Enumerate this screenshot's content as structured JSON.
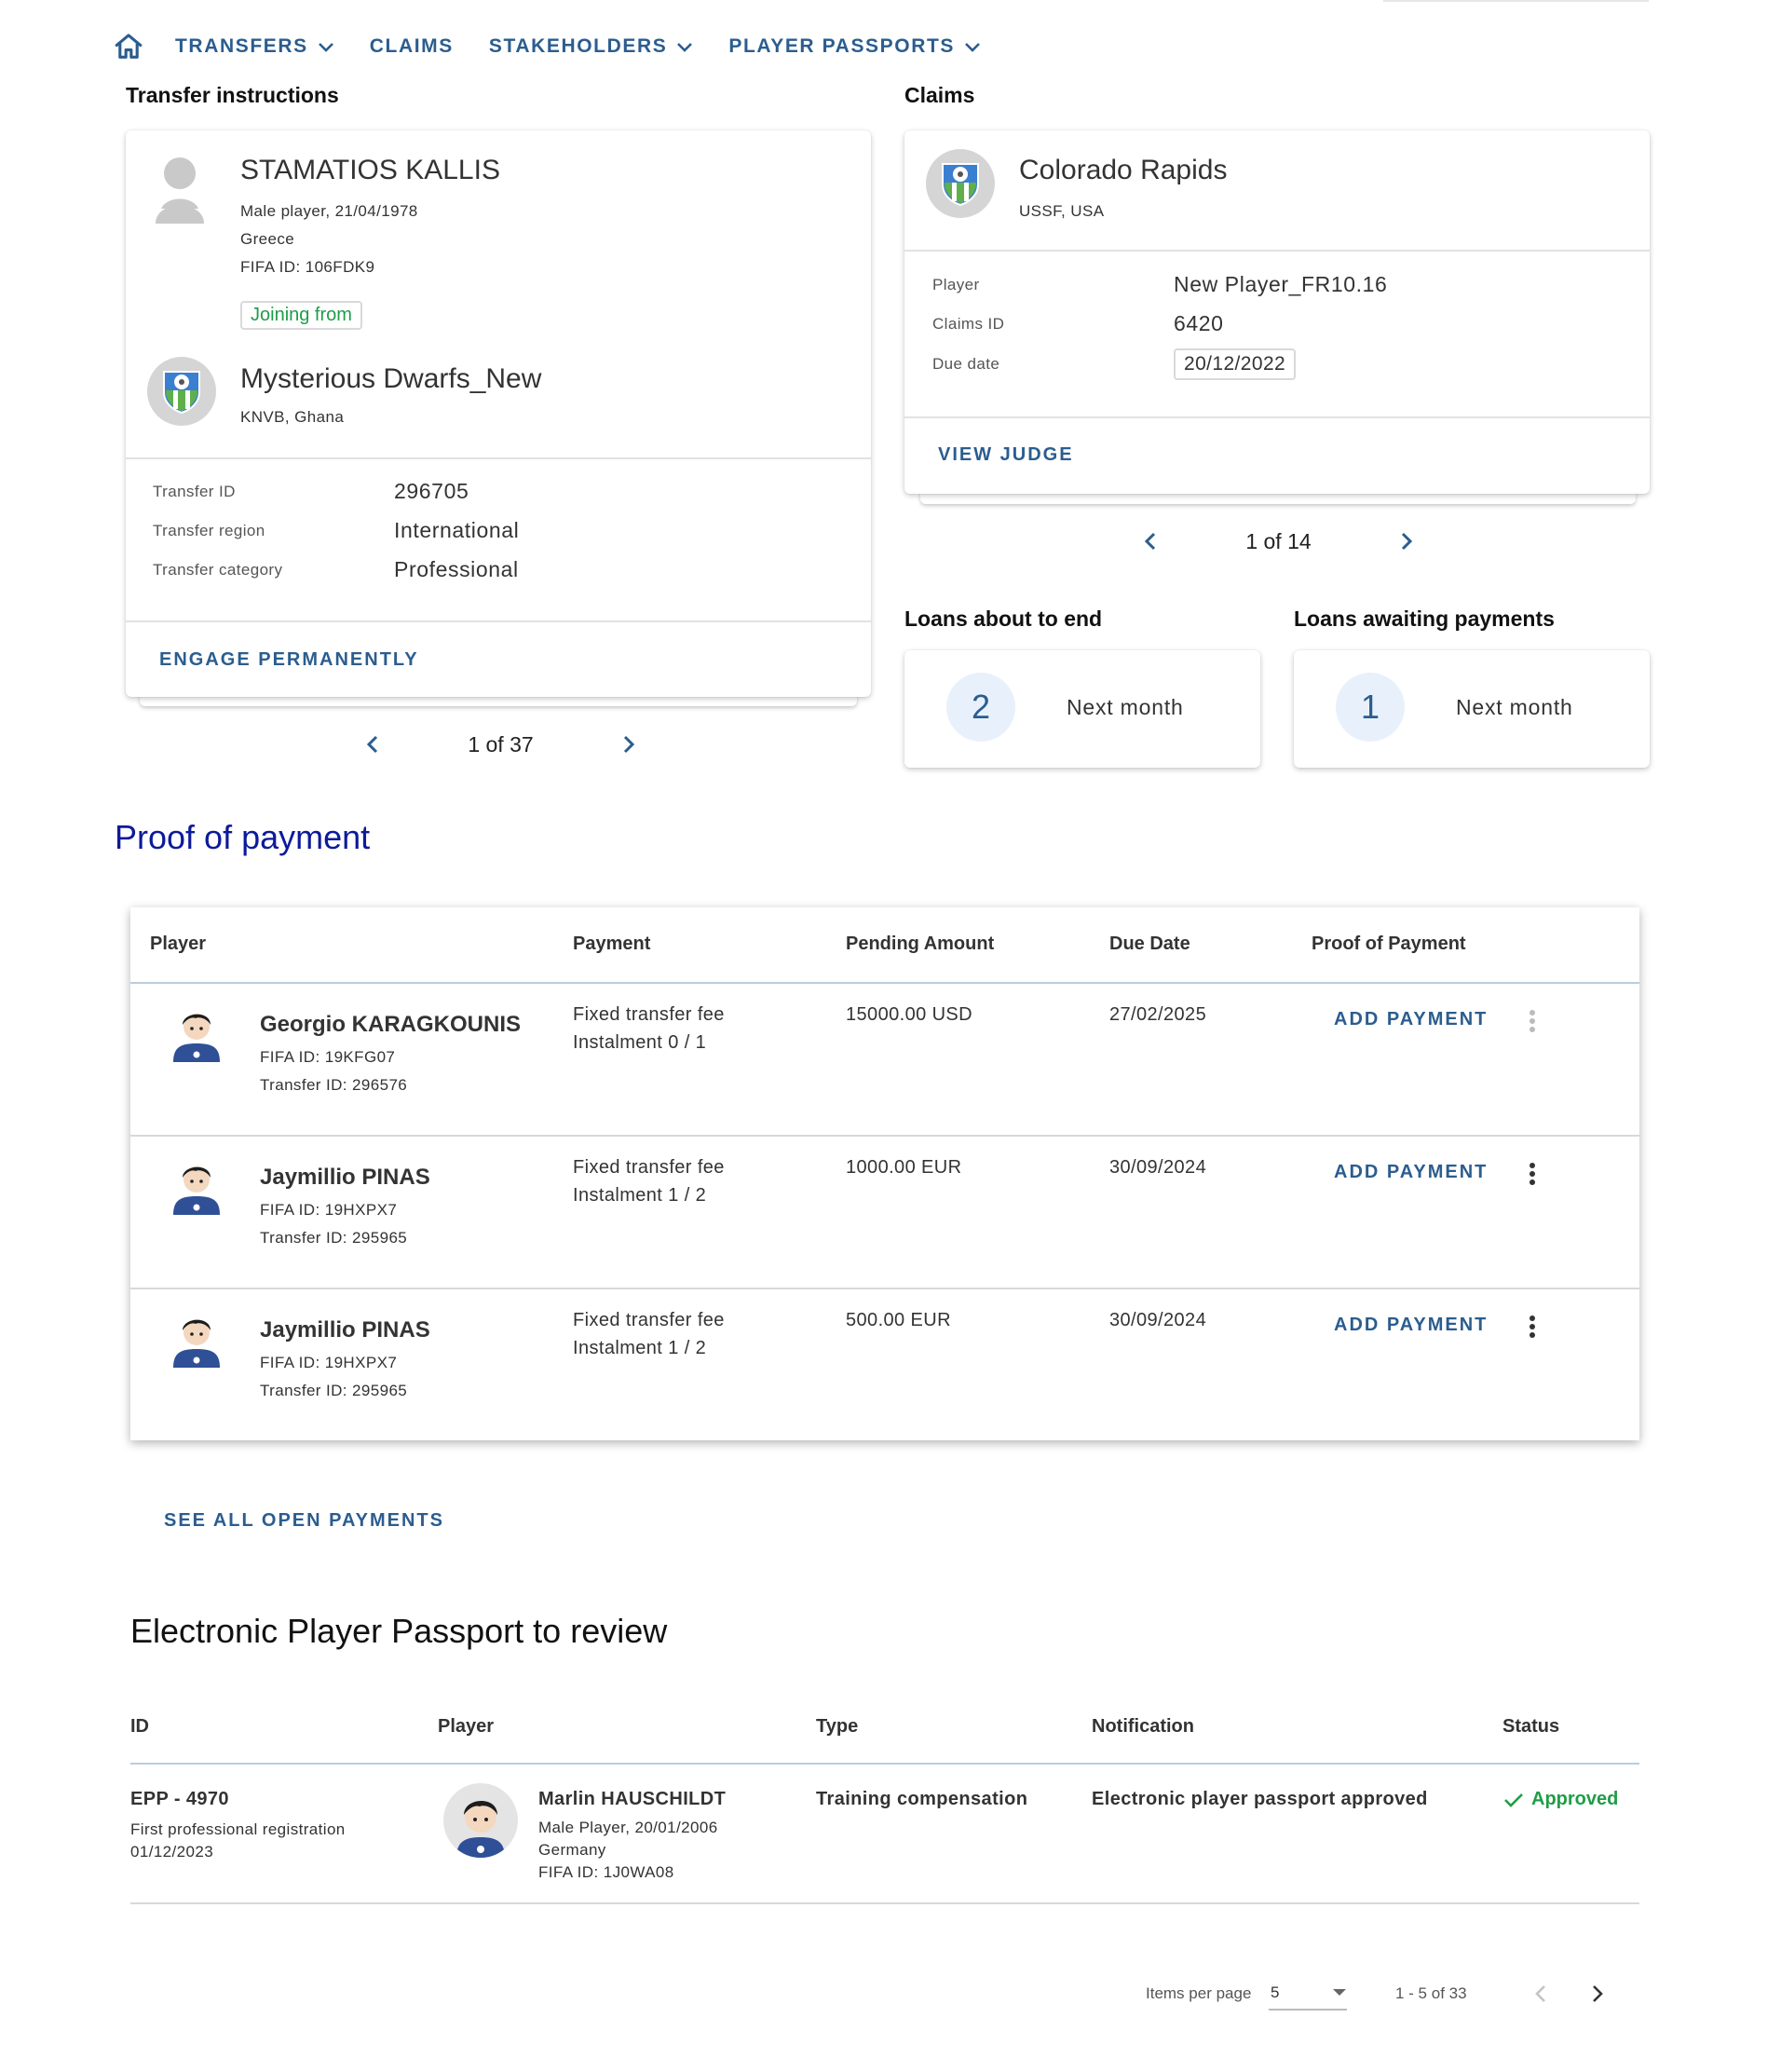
{
  "nav": {
    "items": [
      {
        "label": "TRANSFERS",
        "dropdown": true
      },
      {
        "label": "CLAIMS",
        "dropdown": false
      },
      {
        "label": "STAKEHOLDERS",
        "dropdown": true
      },
      {
        "label": "PLAYER PASSPORTS",
        "dropdown": true
      }
    ]
  },
  "transfer": {
    "section_title": "Transfer instructions",
    "player_name": "STAMATIOS KALLIS",
    "player_line1": "Male player, 21/04/1978",
    "player_line2": "Greece",
    "player_line3": "FIFA ID: 106FDK9",
    "badge": "Joining from",
    "club_name": "Mysterious Dwarfs_New",
    "club_meta": "KNVB, Ghana",
    "fields": [
      {
        "key": "Transfer ID",
        "value": "296705"
      },
      {
        "key": "Transfer region",
        "value": "International"
      },
      {
        "key": "Transfer category",
        "value": "Professional"
      }
    ],
    "action": "ENGAGE PERMANENTLY",
    "pager": "1 of 37"
  },
  "claims": {
    "section_title": "Claims",
    "club_name": "Colorado Rapids",
    "club_meta": "USSF, USA",
    "fields": [
      {
        "key": "Player",
        "value": "New Player_FR10.16"
      },
      {
        "key": "Claims ID",
        "value": "6420"
      },
      {
        "key": "Due date",
        "value": "20/12/2022"
      }
    ],
    "action": "VIEW JUDGE",
    "pager": "1 of 14"
  },
  "loans": {
    "ending": {
      "title": "Loans about to end",
      "count": "2",
      "label": "Next month"
    },
    "awaiting": {
      "title": "Loans awaiting payments",
      "count": "1",
      "label": "Next month"
    }
  },
  "proof": {
    "title": "Proof of payment",
    "headers": [
      "Player",
      "Payment",
      "Pending Amount",
      "Due Date",
      "Proof of Payment"
    ],
    "rows": [
      {
        "name": "Georgio KARAGKOUNIS",
        "fifa": "FIFA ID: 19KFG07",
        "transfer": "Transfer ID: 296576",
        "payment1": "Fixed transfer fee",
        "payment2": "Instalment 0 / 1",
        "amount": "15000.00 USD",
        "due": "27/02/2025",
        "action": "ADD PAYMENT"
      },
      {
        "name": "Jaymillio PINAS",
        "fifa": "FIFA ID: 19HXPX7",
        "transfer": "Transfer ID: 295965",
        "payment1": "Fixed transfer fee",
        "payment2": "Instalment 1 / 2",
        "amount": "1000.00 EUR",
        "due": "30/09/2024",
        "action": "ADD PAYMENT"
      },
      {
        "name": "Jaymillio PINAS",
        "fifa": "FIFA ID: 19HXPX7",
        "transfer": "Transfer ID: 295965",
        "payment1": "Fixed transfer fee",
        "payment2": "Instalment 1 / 2",
        "amount": "500.00 EUR",
        "due": "30/09/2024",
        "action": "ADD PAYMENT"
      }
    ],
    "see_all": "SEE ALL OPEN PAYMENTS"
  },
  "epp": {
    "title": "Electronic Player Passport to review",
    "headers": [
      "ID",
      "Player",
      "Type",
      "Notification",
      "Status"
    ],
    "row": {
      "id": "EPP - 4970",
      "id_sub1": "First professional registration",
      "id_sub2": "01/12/2023",
      "player_name": "Marlin HAUSCHILDT",
      "player_line1": "Male Player, 20/01/2006",
      "player_line2": "Germany",
      "player_line3": "FIFA ID: 1J0WA08",
      "type": "Training compensation",
      "notification": "Electronic player passport approved",
      "status": "Approved"
    }
  },
  "paginator": {
    "items_label": "Items per page",
    "page_size": "5",
    "range": "1 - 5 of 33"
  },
  "colors": {
    "accent": "#2b5d8f",
    "heading_blue": "#0d1a99",
    "success": "#1f9d48"
  }
}
